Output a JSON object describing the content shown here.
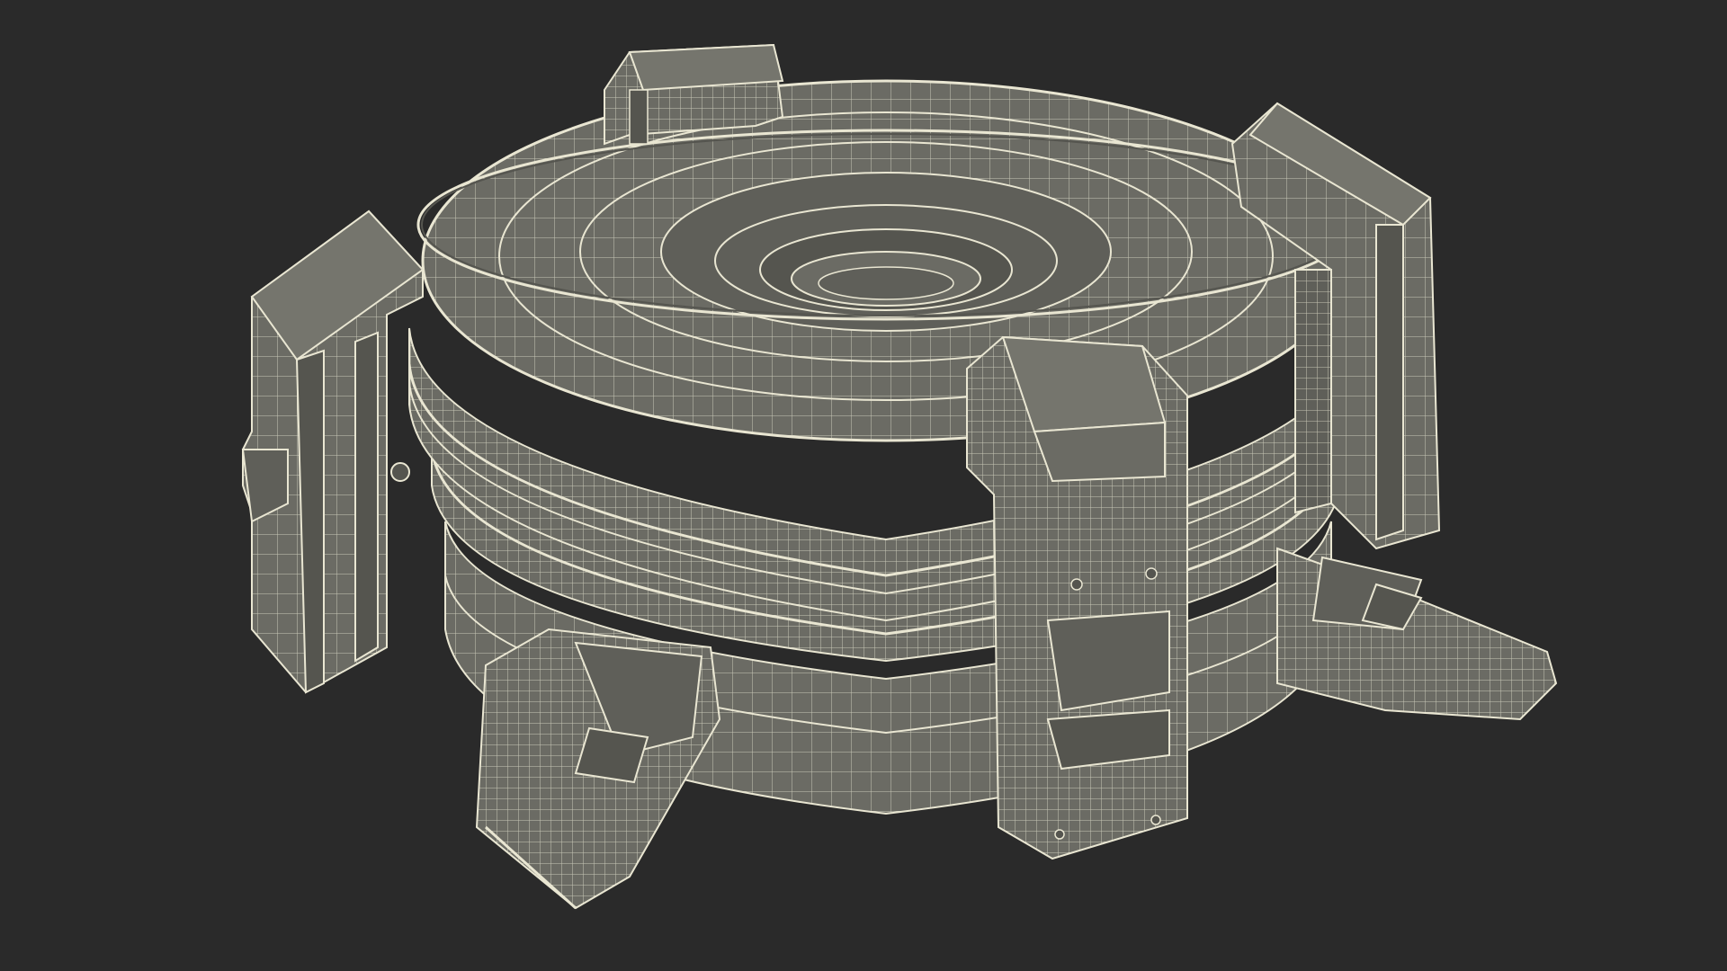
{
  "scene": {
    "subject": "scifi-platform-wireframe",
    "background_color": "#2a2a2a",
    "mesh_color": "#6b6b64",
    "mesh_dark_color": "#55554f",
    "wire_color": "#e9e6d2",
    "shade_color": "#3d3d39",
    "icons": [
      "platform-wireframe-render"
    ]
  }
}
